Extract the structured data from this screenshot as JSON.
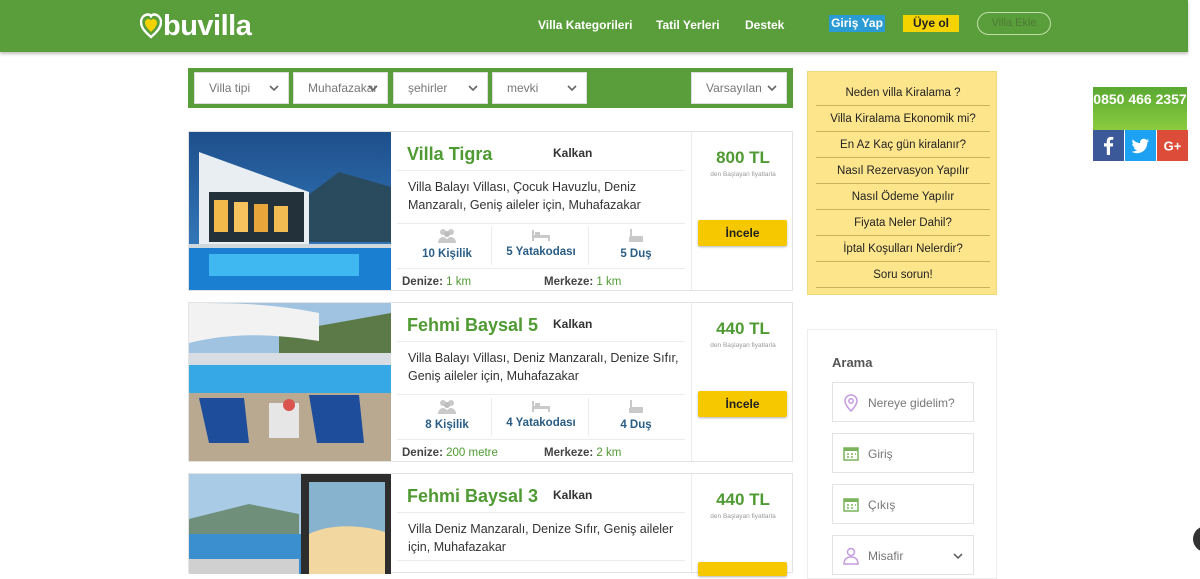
{
  "header": {
    "logo_text": "buvilla",
    "nav": [
      "Villa Kategorileri",
      "Tatil Yerleri",
      "Destek"
    ],
    "login_label": "Giriş Yap",
    "register_label": "Üye ol",
    "add_villa_label": "Villa Ekle"
  },
  "filters": {
    "villa_type": "Villa tipi",
    "category": "Muhafazakar",
    "city": "şehirler",
    "location": "mevki",
    "sort": "Varsayılan"
  },
  "listings": [
    {
      "title": "Villa Tigra",
      "location": "Kalkan",
      "description": "Villa Balayı Villası, Çocuk Havuzlu, Deniz Manzaralı, Geniş aileler için, Muhafazakar",
      "capacity": "10 Kişilik",
      "bedrooms": "5 Yatakodası",
      "showers": "5 Duş",
      "sea_label": "Denize:",
      "sea_distance": "1 km",
      "center_label": "Merkeze:",
      "center_distance": "1 km",
      "price": "800 TL",
      "price_note": "den Başlayan fiyatlarla",
      "button": "İncele"
    },
    {
      "title": "Fehmi Baysal 5",
      "location": "Kalkan",
      "description": "Villa Balayı Villası, Deniz Manzaralı, Denize Sıfır, Geniş aileler için, Muhafazakar",
      "capacity": "8 Kişilik",
      "bedrooms": "4 Yatakodası",
      "showers": "4 Duş",
      "sea_label": "Denize:",
      "sea_distance": "200 metre",
      "center_label": "Merkeze:",
      "center_distance": "2 km",
      "price": "440 TL",
      "price_note": "den Başlayan fiyatlarla",
      "button": "İncele"
    },
    {
      "title": "Fehmi Baysal 3",
      "location": "Kalkan",
      "description": "Villa Deniz Manzaralı, Denize Sıfır, Geniş aileler için, Muhafazakar",
      "price": "440 TL",
      "price_note": "den Başlayan fiyatlarla"
    }
  ],
  "faq": [
    "Neden villa Kiralama ?",
    "Villa Kiralama Ekonomik mi?",
    "En Az Kaç gün kiralanır?",
    "Nasıl Rezervasyon Yapılır",
    "Nasıl Ödeme Yapılır",
    "Fiyata Neler Dahil?",
    "İptal Koşulları Nelerdir?",
    "Soru sorun!"
  ],
  "search": {
    "title": "Arama",
    "destination_placeholder": "Nereye gidelim?",
    "checkin_placeholder": "Giriş",
    "checkout_placeholder": "Çıkış",
    "guests_placeholder": "Misafir"
  },
  "contact": {
    "phone": "0850 466 2357"
  },
  "colors": {
    "brand_green": "#5a9e3c",
    "accent_yellow": "#f5c800",
    "faq_bg": "#fde58c",
    "login_blue": "#2b9bd4"
  },
  "icons": [
    "heart-logo-icon",
    "chevron-down-icon",
    "people-icon",
    "bed-icon",
    "shower-icon",
    "location-pin-icon",
    "calendar-icon",
    "user-icon",
    "facebook-icon",
    "twitter-icon",
    "google-plus-icon"
  ]
}
